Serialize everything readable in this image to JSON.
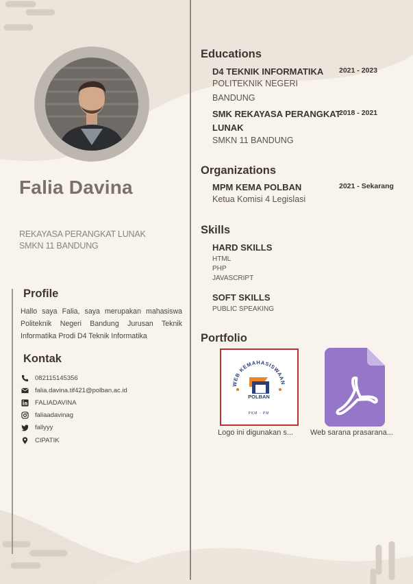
{
  "header": {
    "name": "Falia Davina",
    "role_line1": "REKAYASA PERANGKAT LUNAK",
    "role_line2": "SMKN 11 BANDUNG"
  },
  "profile": {
    "title": "Profile",
    "text": "Hallo saya Falia, saya merupakan mahasiswa Politeknik Negeri Bandung Jurusan Teknik Informatika Prodi D4 Teknik Informatika"
  },
  "contact": {
    "title": "Kontak",
    "items": [
      {
        "icon": "phone-icon",
        "text": "082115145356"
      },
      {
        "icon": "email-icon",
        "text": "falia.davina.tif421@polban.ac.id"
      },
      {
        "icon": "linkedin-icon",
        "text": "FALIADAVINA"
      },
      {
        "icon": "instagram-icon",
        "text": "faliaadavinag"
      },
      {
        "icon": "twitter-icon",
        "text": "fallyyy"
      },
      {
        "icon": "location-pin-icon",
        "text": "CIPATIK"
      }
    ]
  },
  "educations": {
    "title": "Educations",
    "items": [
      {
        "title": "D4 TEKNIK INFORMATIKA",
        "sub1": "POLITEKNIK NEGERI",
        "sub2": "BANDUNG",
        "date": "2021 - 2023"
      },
      {
        "title1": "SMK REKAYASA PERANGKAT",
        "title2": "LUNAK",
        "sub": "SMKN 11 BANDUNG",
        "date": "2018 - 2021"
      }
    ]
  },
  "organizations": {
    "title": "Organizations",
    "items": [
      {
        "title": "MPM KEMA POLBAN",
        "sub": "Ketua Komisi 4 Legislasi",
        "date": "2021 - Sekarang"
      }
    ]
  },
  "skills": {
    "title": "Skills",
    "hard_title": "HARD SKILLS",
    "hard_items": [
      "HTML",
      "PHP",
      "JAVASCRIPT"
    ],
    "soft_title": "SOFT SKILLS",
    "soft_items": [
      "PUBLIC SPEAKING"
    ]
  },
  "portfolio": {
    "title": "Portfolio",
    "items": [
      {
        "caption": "Logo ini digunakan s...",
        "logo_ring_text": "WEB KEMAHASISWAAN",
        "logo_center": "POLBAN",
        "logo_bottom": "PKM - PM"
      },
      {
        "caption": "Web sarana prasarana..."
      }
    ]
  },
  "colors": {
    "background": "#f8f4ed",
    "accent_shape": "#ebe4db",
    "photo_ring": "#bdb6af",
    "name_text": "#7b716b",
    "pdf_icon": "#9576c8",
    "logo_border": "#b83030"
  }
}
